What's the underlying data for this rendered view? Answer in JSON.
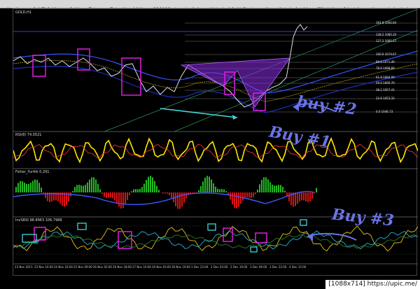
{
  "tabs": [
    {
      "label": "Nasdaq"
    },
    {
      "label": "GoldToGold.com, Gold"
    },
    {
      "label": "Tr Ing"
    },
    {
      "label": "Tr Ing New bkkk"
    },
    {
      "label": "RBO123 - Investasitab"
    },
    {
      "label": "Historical Gold Charts"
    },
    {
      "label": "Kagu Historical gold"
    },
    {
      "label": "Elliott Wave Principle"
    },
    {
      "label": "Harmonic Analysis"
    }
  ],
  "panes": {
    "main": {
      "label": "GOLD,H1"
    },
    "rsi": {
      "label": "RSI(8) 74.0521"
    },
    "fisher": {
      "label": "Fisher_Yur4ik 0.291"
    },
    "stoch": {
      "label": "InvSRSI 98.8963 106.7968"
    }
  },
  "fib_levels": [
    {
      "label": "161.8 1092.84"
    },
    {
      "label": "138.2 1085.35"
    },
    {
      "label": "127.2 1082.27"
    },
    {
      "label": "100.0 1074.67"
    },
    {
      "label": "88.6 1071.49"
    },
    {
      "label": "78.6 1068.69"
    },
    {
      "label": "61.8 1064.00"
    },
    {
      "label": "50.0 1060.70"
    },
    {
      "label": "38.2 1057.41"
    },
    {
      "label": "23.6 1053.33"
    },
    {
      "label": "0.0 1046.73"
    }
  ],
  "time_axis": [
    "23 Nov 2015",
    "23 Nov 16:00",
    "24 Nov 16:00",
    "25 Nov 09:00",
    "26 Nov 02:00",
    "26 Nov 18:00",
    "27 Nov 10:00",
    "30 Nov 03:00",
    "30 Nov 19:00",
    "1 Dec 23:00",
    "2 Dec 03:00",
    "2 Dec 19:00",
    "3 Dec 06:00",
    "3 Dec 22:00",
    "4 Dec 15:00"
  ],
  "annotations": {
    "buy2": "buy #2",
    "buy1": "Buy #1",
    "buy3": "Buy #3"
  },
  "colors": {
    "highlight_box": "#e01ee0",
    "cyan_box": "#3fd8d8",
    "harmonic_pattern": "#8a2be2",
    "annotation_ink": "#6b73e6",
    "rsi_line": "#ffe600",
    "fisher_up": "#22bb22",
    "fisher_down": "#dd1111"
  },
  "footer": {
    "text": "[1088x714] https://upic.me/"
  }
}
